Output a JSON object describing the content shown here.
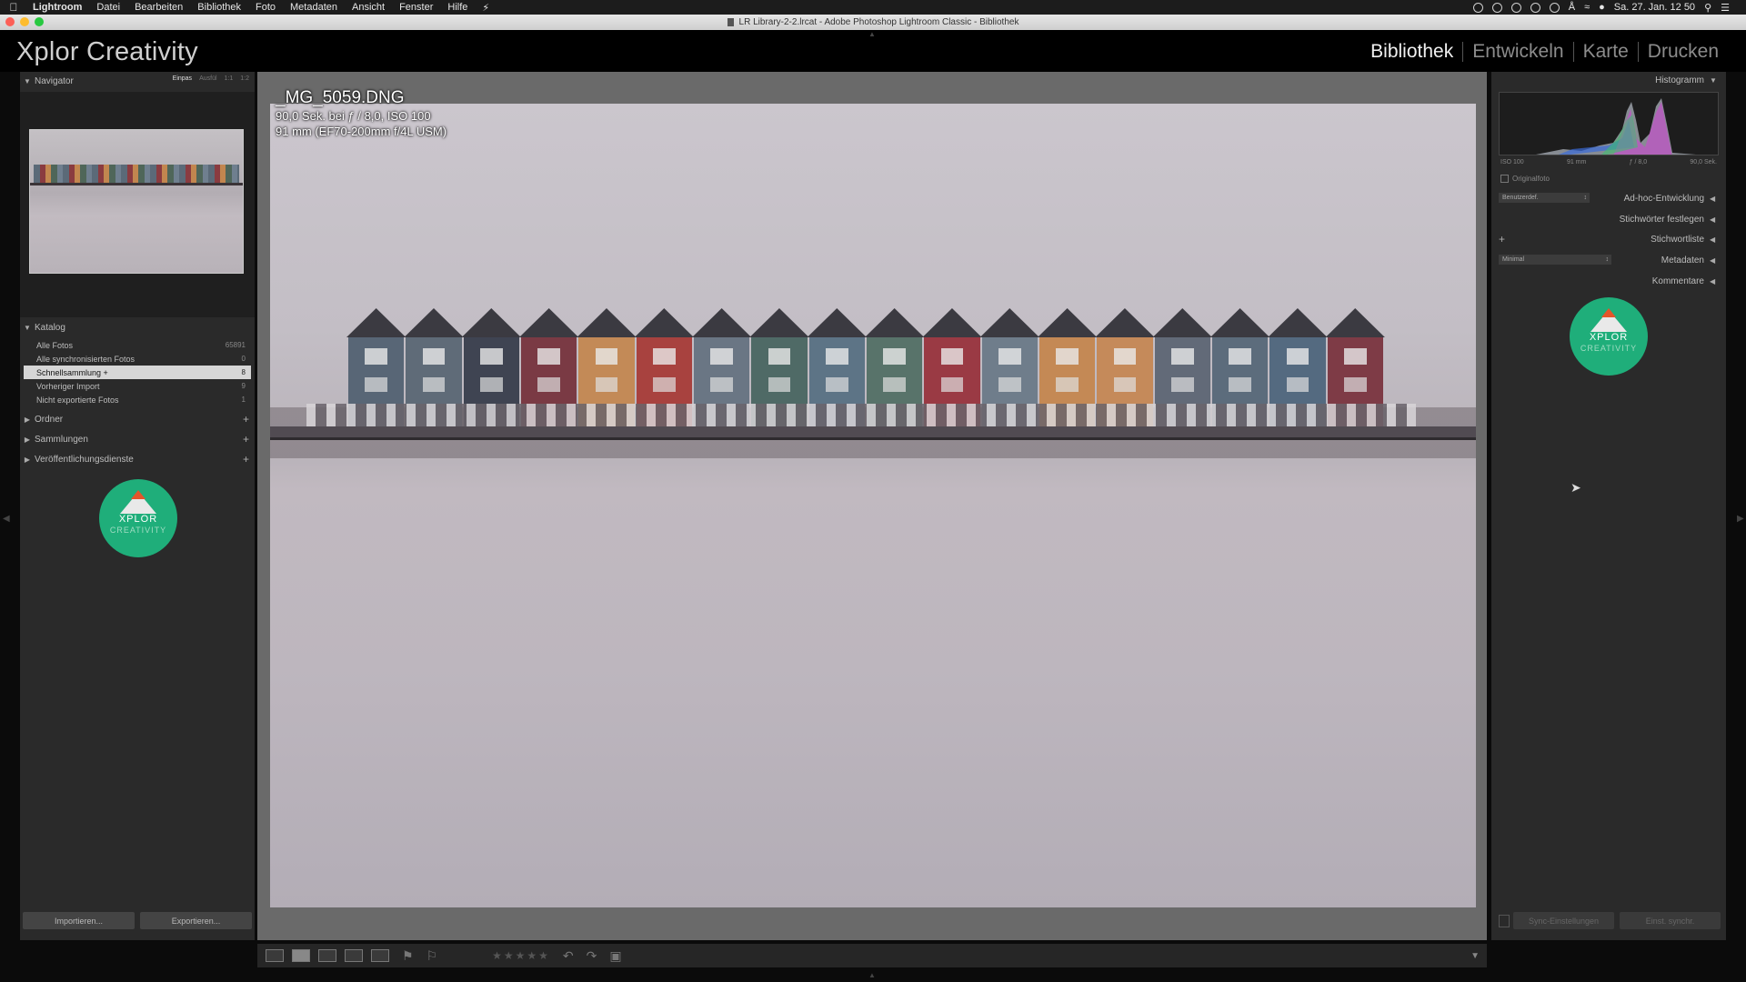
{
  "menubar": {
    "items": [
      "Lightroom",
      "Datei",
      "Bearbeiten",
      "Bibliothek",
      "Foto",
      "Metadaten",
      "Ansicht",
      "Fenster",
      "Hilfe"
    ],
    "clock": "Sa. 27. Jan. 12 50"
  },
  "window": {
    "title": "LR Library-2-2.lrcat - Adobe Photoshop Lightroom Classic - Bibliothek"
  },
  "identity": {
    "brand": "Xplor Creativity",
    "modules": [
      "Bibliothek",
      "Entwickeln",
      "Karte",
      "Drucken"
    ],
    "active_module": "Bibliothek"
  },
  "left": {
    "navigator": {
      "title": "Navigator",
      "modes": [
        "Einpas",
        "Ausfül",
        "1:1",
        "1:2"
      ]
    },
    "catalog": {
      "title": "Katalog",
      "items": [
        {
          "label": "Alle Fotos",
          "count": "65891"
        },
        {
          "label": "Alle synchronisierten Fotos",
          "count": "0"
        },
        {
          "label": "Schnellsammlung +",
          "count": "8"
        },
        {
          "label": "Vorheriger Import",
          "count": "9"
        },
        {
          "label": "Nicht exportierte Fotos",
          "count": "1"
        }
      ]
    },
    "sections": [
      "Ordner",
      "Sammlungen",
      "Veröffentlichungsdienste"
    ],
    "import_label": "Importieren...",
    "export_label": "Exportieren..."
  },
  "logo": {
    "line1": "XPLOR",
    "line2": "CREATIVITY"
  },
  "photo": {
    "filename": "_MG_5059.DNG",
    "exposure": "90,0 Sek. bei ƒ / 8,0, ISO 100",
    "lens": "91 mm (EF70-200mm f/4L USM)"
  },
  "toolbar": {
    "stars": "★★★★★"
  },
  "right": {
    "histogram_title": "Histogramm",
    "histo_labels": [
      "ISO 100",
      "91 mm",
      "ƒ / 8,0",
      "90,0 Sek."
    ],
    "original_photo": "Originalfoto",
    "preset_select": "Benutzerdef.",
    "quick_develop": "Ad-hoc-Entwicklung",
    "keywording": "Stichwörter festlegen",
    "keyword_list": "Stichwortliste",
    "metadata_select": "Minimal",
    "metadata": "Metadaten",
    "comments": "Kommentare",
    "sync_label": "Sync-Einstellungen",
    "sync_settings_label": "Einst. synchr."
  }
}
